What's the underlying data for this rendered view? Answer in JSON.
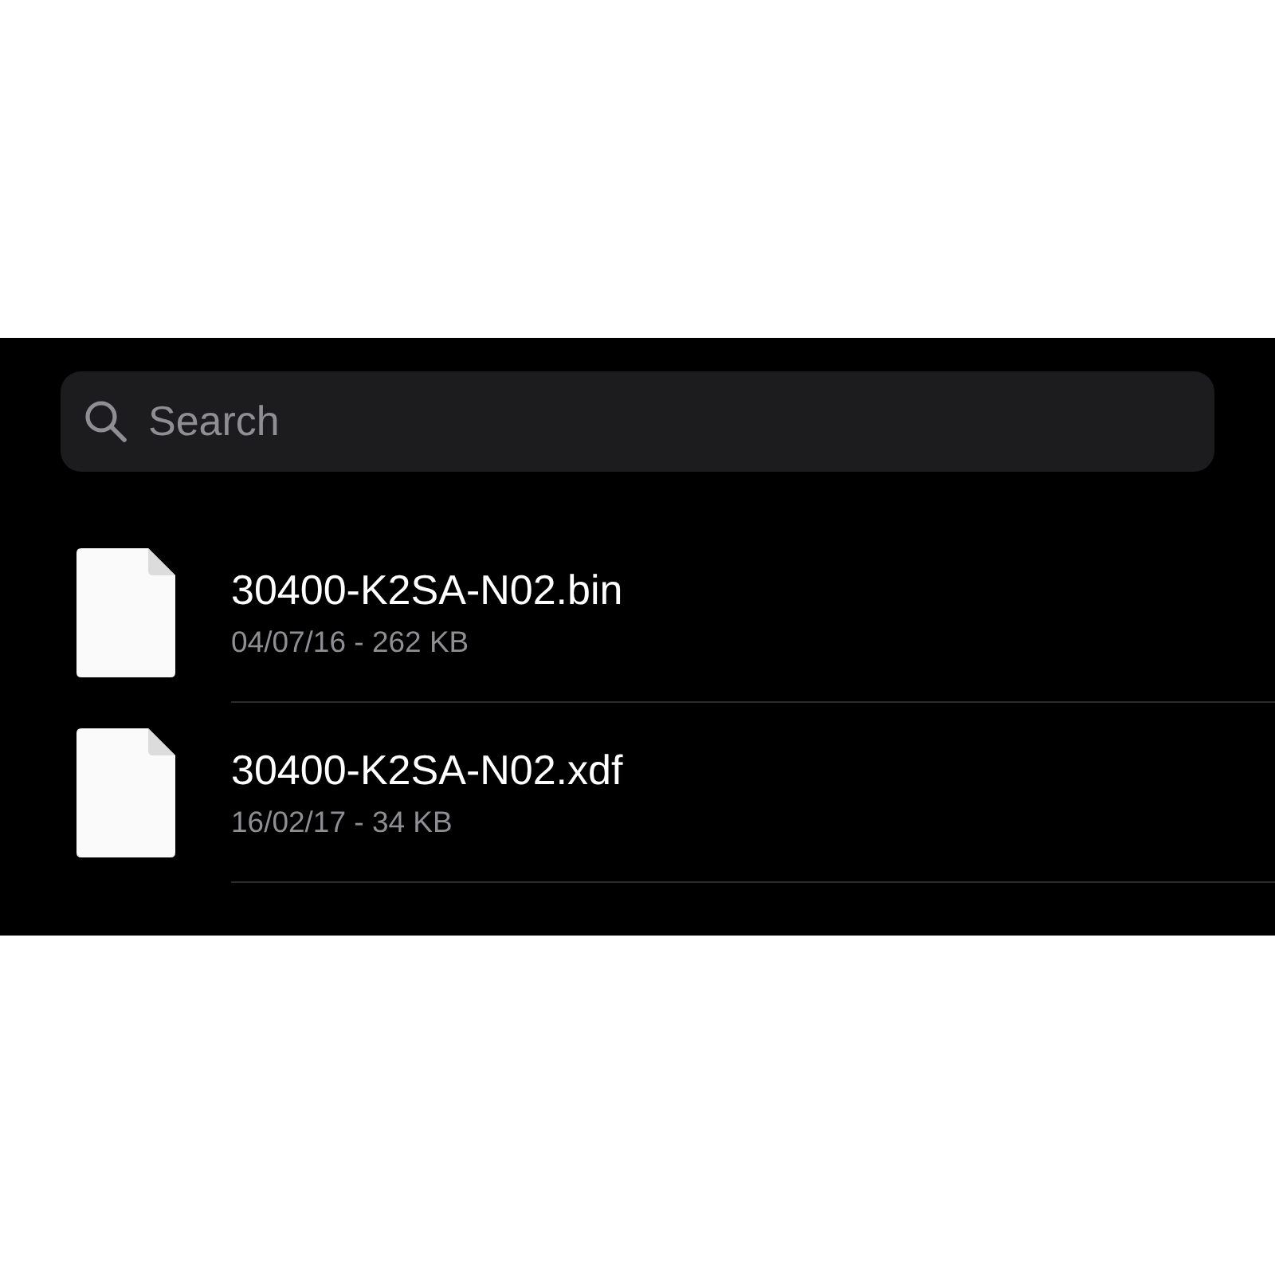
{
  "search": {
    "placeholder": "Search"
  },
  "files": [
    {
      "name": "30400-K2SA-N02.bin",
      "details": "04/07/16 - 262 KB"
    },
    {
      "name": "30400-K2SA-N02.xdf",
      "details": "16/02/17 - 34 KB"
    }
  ]
}
